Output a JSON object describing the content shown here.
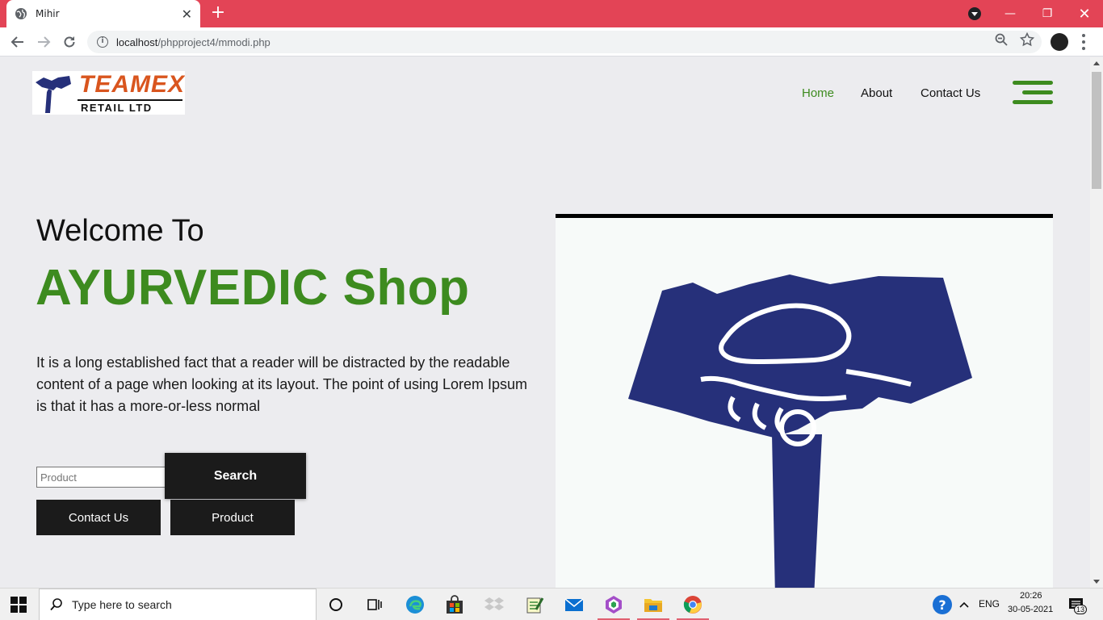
{
  "browser": {
    "tab_title": "Mihir",
    "url_host": "localhost",
    "url_path": "/phpproject4/mmodi.php"
  },
  "site": {
    "logo": {
      "word": "TEAMEX",
      "sub": "RETAIL LTD"
    },
    "nav": [
      {
        "label": "Home",
        "active": true
      },
      {
        "label": "About",
        "active": false
      },
      {
        "label": "Contact Us",
        "active": false
      }
    ],
    "hero": {
      "welcome": "Welcome To",
      "headline": "AYURVEDIC Shop",
      "description": "It is a long established fact that a reader will be distracted by the readable content of a page when looking at its layout. The point of using Lorem Ipsum is that it has a more-or-less normal"
    },
    "search": {
      "placeholder": "Product",
      "button": "Search"
    },
    "buttons": {
      "contact": "Contact Us",
      "product": "Product"
    },
    "colors": {
      "accent": "#3d8b1f",
      "dark": "#1b1b1b",
      "handshake": "#26307a"
    }
  },
  "taskbar": {
    "search_placeholder": "Type here to search",
    "language": "ENG",
    "time": "20:26",
    "date": "30-05-2021",
    "notifications": "13"
  }
}
